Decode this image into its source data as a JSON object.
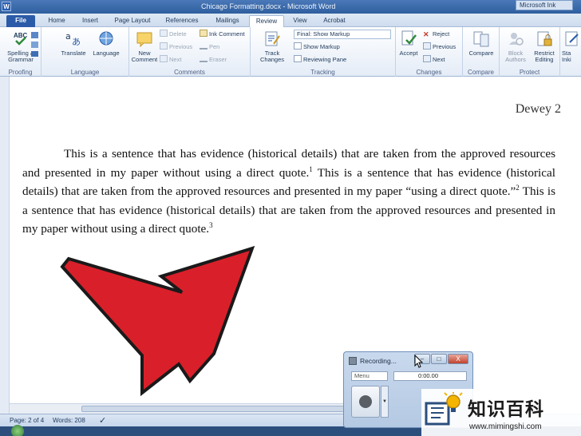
{
  "window": {
    "app_letter": "W",
    "title": "Chicago Formatting.docx - Microsoft Word",
    "account": "Microsoft Ink"
  },
  "tabs": [
    {
      "label": "File"
    },
    {
      "label": "Home"
    },
    {
      "label": "Insert"
    },
    {
      "label": "Page Layout"
    },
    {
      "label": "References"
    },
    {
      "label": "Mailings"
    },
    {
      "label": "Review"
    },
    {
      "label": "View"
    },
    {
      "label": "Acrobat"
    }
  ],
  "ribbon": {
    "proofing": {
      "label": "Proofing",
      "spelling": "Spelling &",
      "grammar": "Grammar"
    },
    "language": {
      "label": "Language",
      "translate": "Translate",
      "language": "Language"
    },
    "comments": {
      "label": "Comments",
      "new": "New",
      "comment": "Comment",
      "delete": "Delete",
      "previous": "Previous",
      "next": "Next"
    },
    "ink": {
      "ink_comment": "Ink Comment",
      "pen": "Pen",
      "eraser": "Eraser"
    },
    "tracking": {
      "label": "Tracking",
      "track": "Track",
      "changes": "Changes",
      "final_markup": "Final: Show Markup",
      "show_markup": "Show Markup",
      "reviewing_pane": "Reviewing Pane"
    },
    "changes": {
      "label": "Changes",
      "accept": "Accept",
      "reject": "Reject",
      "previous": "Previous",
      "next": "Next"
    },
    "compare": {
      "label": "Compare",
      "compare": "Compare"
    },
    "protect": {
      "label": "Protect",
      "block": "Block",
      "authors": "Authors",
      "restrict": "Restrict",
      "editing": "Editing"
    },
    "extra": {
      "sta": "Sta",
      "inki": "Inki"
    }
  },
  "document": {
    "header": "Dewey 2",
    "paragraph": {
      "s1": "This is a sentence that has evidence (historical details) that are taken from the approved resources and presented in my paper without using a direct quote.",
      "fn1": "1",
      "s2": " This is a sentence that has evidence (historical details) that are taken from the approved resources and presented in my paper “using a direct quote.”",
      "fn2": "2",
      "s3": " This is a sentence that has evidence (historical details) that are taken from the approved resources and presented in my paper without using a direct quote.",
      "fn3": "3"
    }
  },
  "statusbar": {
    "page": "Page: 2 of 4",
    "words": "Words: 208"
  },
  "recording_window": {
    "title": "Recording...",
    "menu": "Menu",
    "time": "0:00.00",
    "minimize": "–",
    "maximize": "□",
    "close": "X"
  },
  "watermark": {
    "site_cn": "知识百科",
    "url": "www.mimingshi.com"
  },
  "colors": {
    "arrow": "#d9202a",
    "ribbon_accent": "#2b5ba8"
  }
}
